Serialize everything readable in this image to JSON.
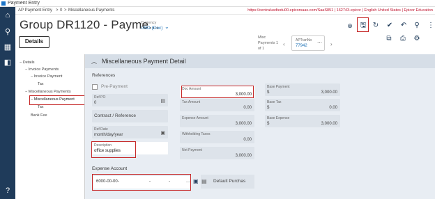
{
  "window": {
    "title": "Payment Entry"
  },
  "breadcrumb": {
    "items": [
      "AP Payment Entry",
      ">",
      "0",
      ">",
      "Miscellaneous Payments"
    ],
    "url_text": "https://centralusdtedu00.epicorsaas.com/SaaS851 | 162743-epicor | English United States | Epicor Education"
  },
  "header": {
    "page_title": "Group DR1120 - Payme...",
    "currency_label": "Currency",
    "currency_value": "USD (Doc)",
    "details_label": "Details",
    "misc_payments_label": "Misc Payments 1 of 1",
    "ap_tab": {
      "label": "APTranNo",
      "value": "77942"
    }
  },
  "tree": {
    "items": [
      {
        "label": "Details",
        "prefix": "−"
      },
      {
        "label": "Invoice Payments",
        "prefix": "−"
      },
      {
        "label": "Invoice Payment",
        "prefix": "−"
      },
      {
        "label": "Tax",
        "prefix": ""
      },
      {
        "label": "Miscellaneous Payments",
        "prefix": "−"
      },
      {
        "label": "Miscellaneous Payment",
        "prefix": "−"
      },
      {
        "label": "Tax",
        "prefix": ""
      },
      {
        "label": "Bank Fee",
        "prefix": ""
      }
    ]
  },
  "section": {
    "title": "Miscellaneous Payment Detail",
    "references_label": "References",
    "pre_payment_label": "Pre-Payment",
    "ref_po": {
      "label": "Ref PO",
      "value": "0"
    },
    "contract_ref_label": "Contract / Reference",
    "ref_date": {
      "label": "Ref Date",
      "value": "month/day/year"
    },
    "description": {
      "label": "Description",
      "value": "office supplies"
    },
    "doc_amount": {
      "label": "Doc Amount",
      "value": "3,000.00"
    },
    "tax_amount": {
      "label": "Tax Amount",
      "value": "0.00"
    },
    "expense_amount": {
      "label": "Expense Amount",
      "value": "3,000.00"
    },
    "withholding_taxes": {
      "label": "Withholding Taxes",
      "value": "0.00"
    },
    "net_payment": {
      "label": "Net Payment",
      "value": "3,000.00"
    },
    "base_payment": {
      "label": "Base Payment",
      "currency": "$",
      "value": "3,000.00"
    },
    "base_tax": {
      "label": "Base Tax",
      "currency": "$",
      "value": "0.00"
    },
    "base_expense": {
      "label": "Base Expense",
      "currency": "$",
      "value": "3,000.00"
    },
    "expense_account_label": "Expense Account",
    "expense_account_value": "6000-00-00-",
    "expense_dash1": "-",
    "expense_dash2": "-",
    "expense_dots": "...",
    "default_purchase_label": "Default Purchas"
  }
}
